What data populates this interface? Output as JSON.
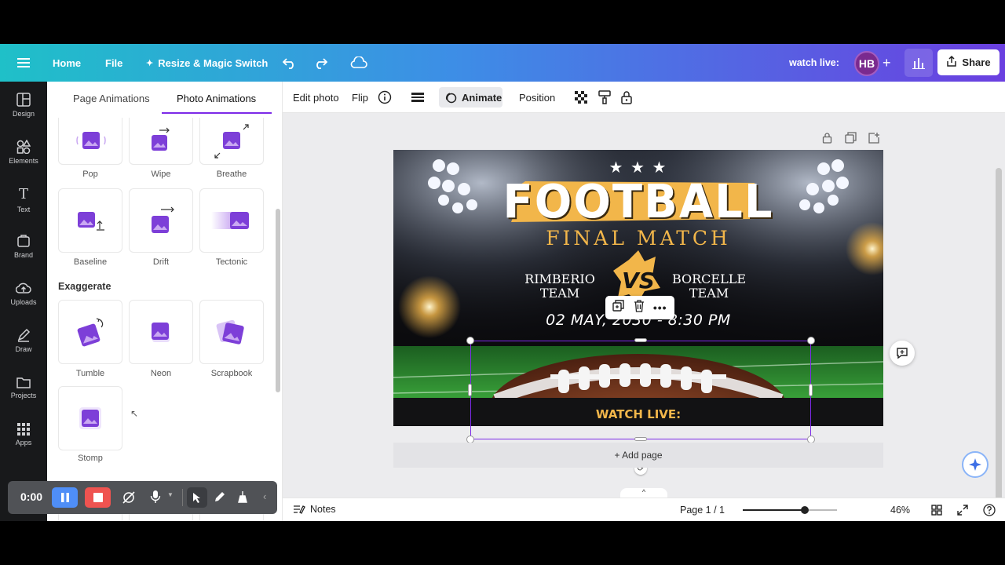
{
  "topbar": {
    "home": "Home",
    "file": "File",
    "resize": "Resize & Magic Switch",
    "watch_live": "watch live:",
    "avatar_initials": "HB",
    "share": "Share"
  },
  "rail": {
    "items": [
      {
        "label": "Design",
        "icon": "design-icon"
      },
      {
        "label": "Elements",
        "icon": "elements-icon"
      },
      {
        "label": "Text",
        "icon": "text-icon"
      },
      {
        "label": "Brand",
        "icon": "brand-icon"
      },
      {
        "label": "Uploads",
        "icon": "uploads-icon"
      },
      {
        "label": "Draw",
        "icon": "draw-icon"
      },
      {
        "label": "Projects",
        "icon": "projects-icon"
      },
      {
        "label": "Apps",
        "icon": "apps-icon"
      }
    ]
  },
  "panel": {
    "tabs": [
      "Page Animations",
      "Photo Animations"
    ],
    "active_tab": "Photo Animations",
    "row1": [
      "Pop",
      "Wipe",
      "Breathe"
    ],
    "row2": [
      "Baseline",
      "Drift",
      "Tectonic"
    ],
    "section_exaggerate": "Exaggerate",
    "row3": [
      "Tumble",
      "Neon",
      "Scrapbook"
    ],
    "row4": [
      "Stomp"
    ]
  },
  "toolbar": {
    "edit_photo": "Edit photo",
    "flip": "Flip",
    "animate": "Animate",
    "position": "Position"
  },
  "design": {
    "title": "FOOTBALL",
    "subtitle": "FINAL MATCH",
    "team_left_1": "RIMBERIO",
    "team_left_2": "TEAM",
    "vs": "VS",
    "team_right_1": "BORCELLE",
    "team_right_2": "TEAM",
    "date": "02 MAY, 2030 - 8:30 PM",
    "watch": "WATCH LIVE:",
    "stars": "★ ★ ★"
  },
  "canvas": {
    "add_page": "+ Add page"
  },
  "bottombar": {
    "notes": "Notes",
    "page": "Page 1 / 1",
    "zoom": "46%",
    "zoom_level": 0.46
  },
  "recorder": {
    "time": "0:00"
  },
  "colors": {
    "accent": "#7d2ae8",
    "gold": "#f2b64a",
    "rail": "#18191b"
  }
}
